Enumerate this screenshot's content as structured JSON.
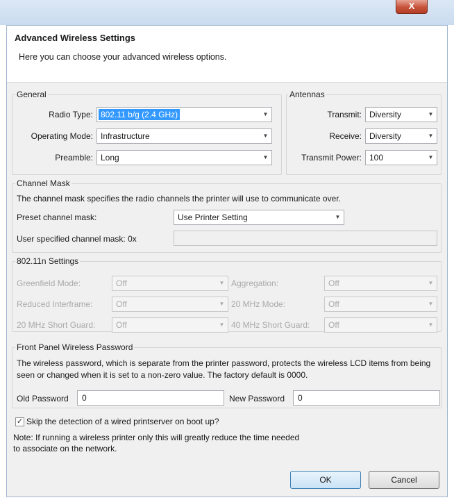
{
  "window": {
    "close_glyph": "X"
  },
  "header": {
    "title": "Advanced Wireless Settings",
    "subtitle": "Here you can choose your advanced wireless options."
  },
  "general": {
    "legend": "General",
    "radio_type": {
      "label": "Radio Type:",
      "value": "802.11 b/g (2.4 GHz)"
    },
    "operating_mode": {
      "label": "Operating Mode:",
      "value": "Infrastructure"
    },
    "preamble": {
      "label": "Preamble:",
      "value": "Long"
    }
  },
  "antennas": {
    "legend": "Antennas",
    "transmit": {
      "label": "Transmit:",
      "value": "Diversity"
    },
    "receive": {
      "label": "Receive:",
      "value": "Diversity"
    },
    "transmit_power": {
      "label": "Transmit Power:",
      "value": "100"
    }
  },
  "channel_mask": {
    "legend": "Channel Mask",
    "description": "The channel mask specifies the radio channels the printer will use to communicate over.",
    "preset_label": "Preset channel mask:",
    "preset_value": "Use Printer Setting",
    "user_label": "User specified channel mask: 0x",
    "user_value": ""
  },
  "n_settings": {
    "legend": "802.11n Settings",
    "greenfield": {
      "label": "Greenfield Mode:",
      "value": "Off"
    },
    "reduced_interframe": {
      "label": "Reduced Interframe:",
      "value": "Off"
    },
    "short_guard_20": {
      "label": "20 MHz Short Guard:",
      "value": "Off"
    },
    "aggregation": {
      "label": "Aggregation:",
      "value": "Off"
    },
    "mode_20mhz": {
      "label": "20 MHz Mode:",
      "value": "Off"
    },
    "short_guard_40": {
      "label": "40 MHz Short Guard:",
      "value": "Off"
    }
  },
  "password": {
    "legend": "Front Panel Wireless Password",
    "description": "The wireless password, which is separate from the printer password, protects the wireless LCD items from being seen or changed when it is set to a non-zero value. The factory default is 0000.",
    "old_label": "Old Password",
    "old_value": "0",
    "new_label": "New Password",
    "new_value": "0"
  },
  "skip_detection": {
    "checked": true,
    "check_glyph": "✓",
    "label": "Skip the detection of a wired printserver on boot up?"
  },
  "note": {
    "line1": "Note: If running a wireless printer only this will greatly reduce the time needed",
    "line2": "to associate on the network."
  },
  "buttons": {
    "ok": "OK",
    "cancel": "Cancel"
  },
  "icons": {
    "dropdown": "▼"
  }
}
